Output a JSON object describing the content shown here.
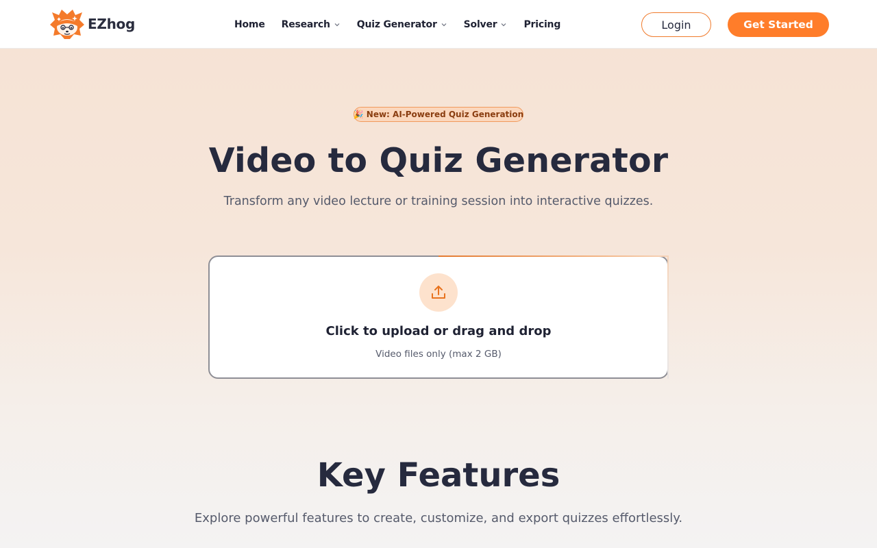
{
  "brand": {
    "name": "EZhog",
    "accent": "#ff7d2a",
    "logo_icon": "hedgehog-logo-icon"
  },
  "nav": {
    "items": [
      {
        "label": "Home",
        "has_dropdown": false
      },
      {
        "label": "Research",
        "has_dropdown": true
      },
      {
        "label": "Quiz Generator",
        "has_dropdown": true
      },
      {
        "label": "Solver",
        "has_dropdown": true
      },
      {
        "label": "Pricing",
        "has_dropdown": false
      }
    ],
    "login_label": "Login",
    "cta_label": "Get Started"
  },
  "hero": {
    "badge_emoji": "🎉",
    "badge": "New: AI-Powered Quiz Generation",
    "title": "Video to Quiz Generator",
    "subtitle": "Transform any video lecture or training session into interactive quizzes."
  },
  "upload": {
    "icon": "upload-icon",
    "title": "Click to upload or drag and drop",
    "note": "Video files only (max 2 GB)"
  },
  "features": {
    "title": "Key Features",
    "subtitle": "Explore powerful features to create, customize, and export quizzes effortlessly."
  }
}
